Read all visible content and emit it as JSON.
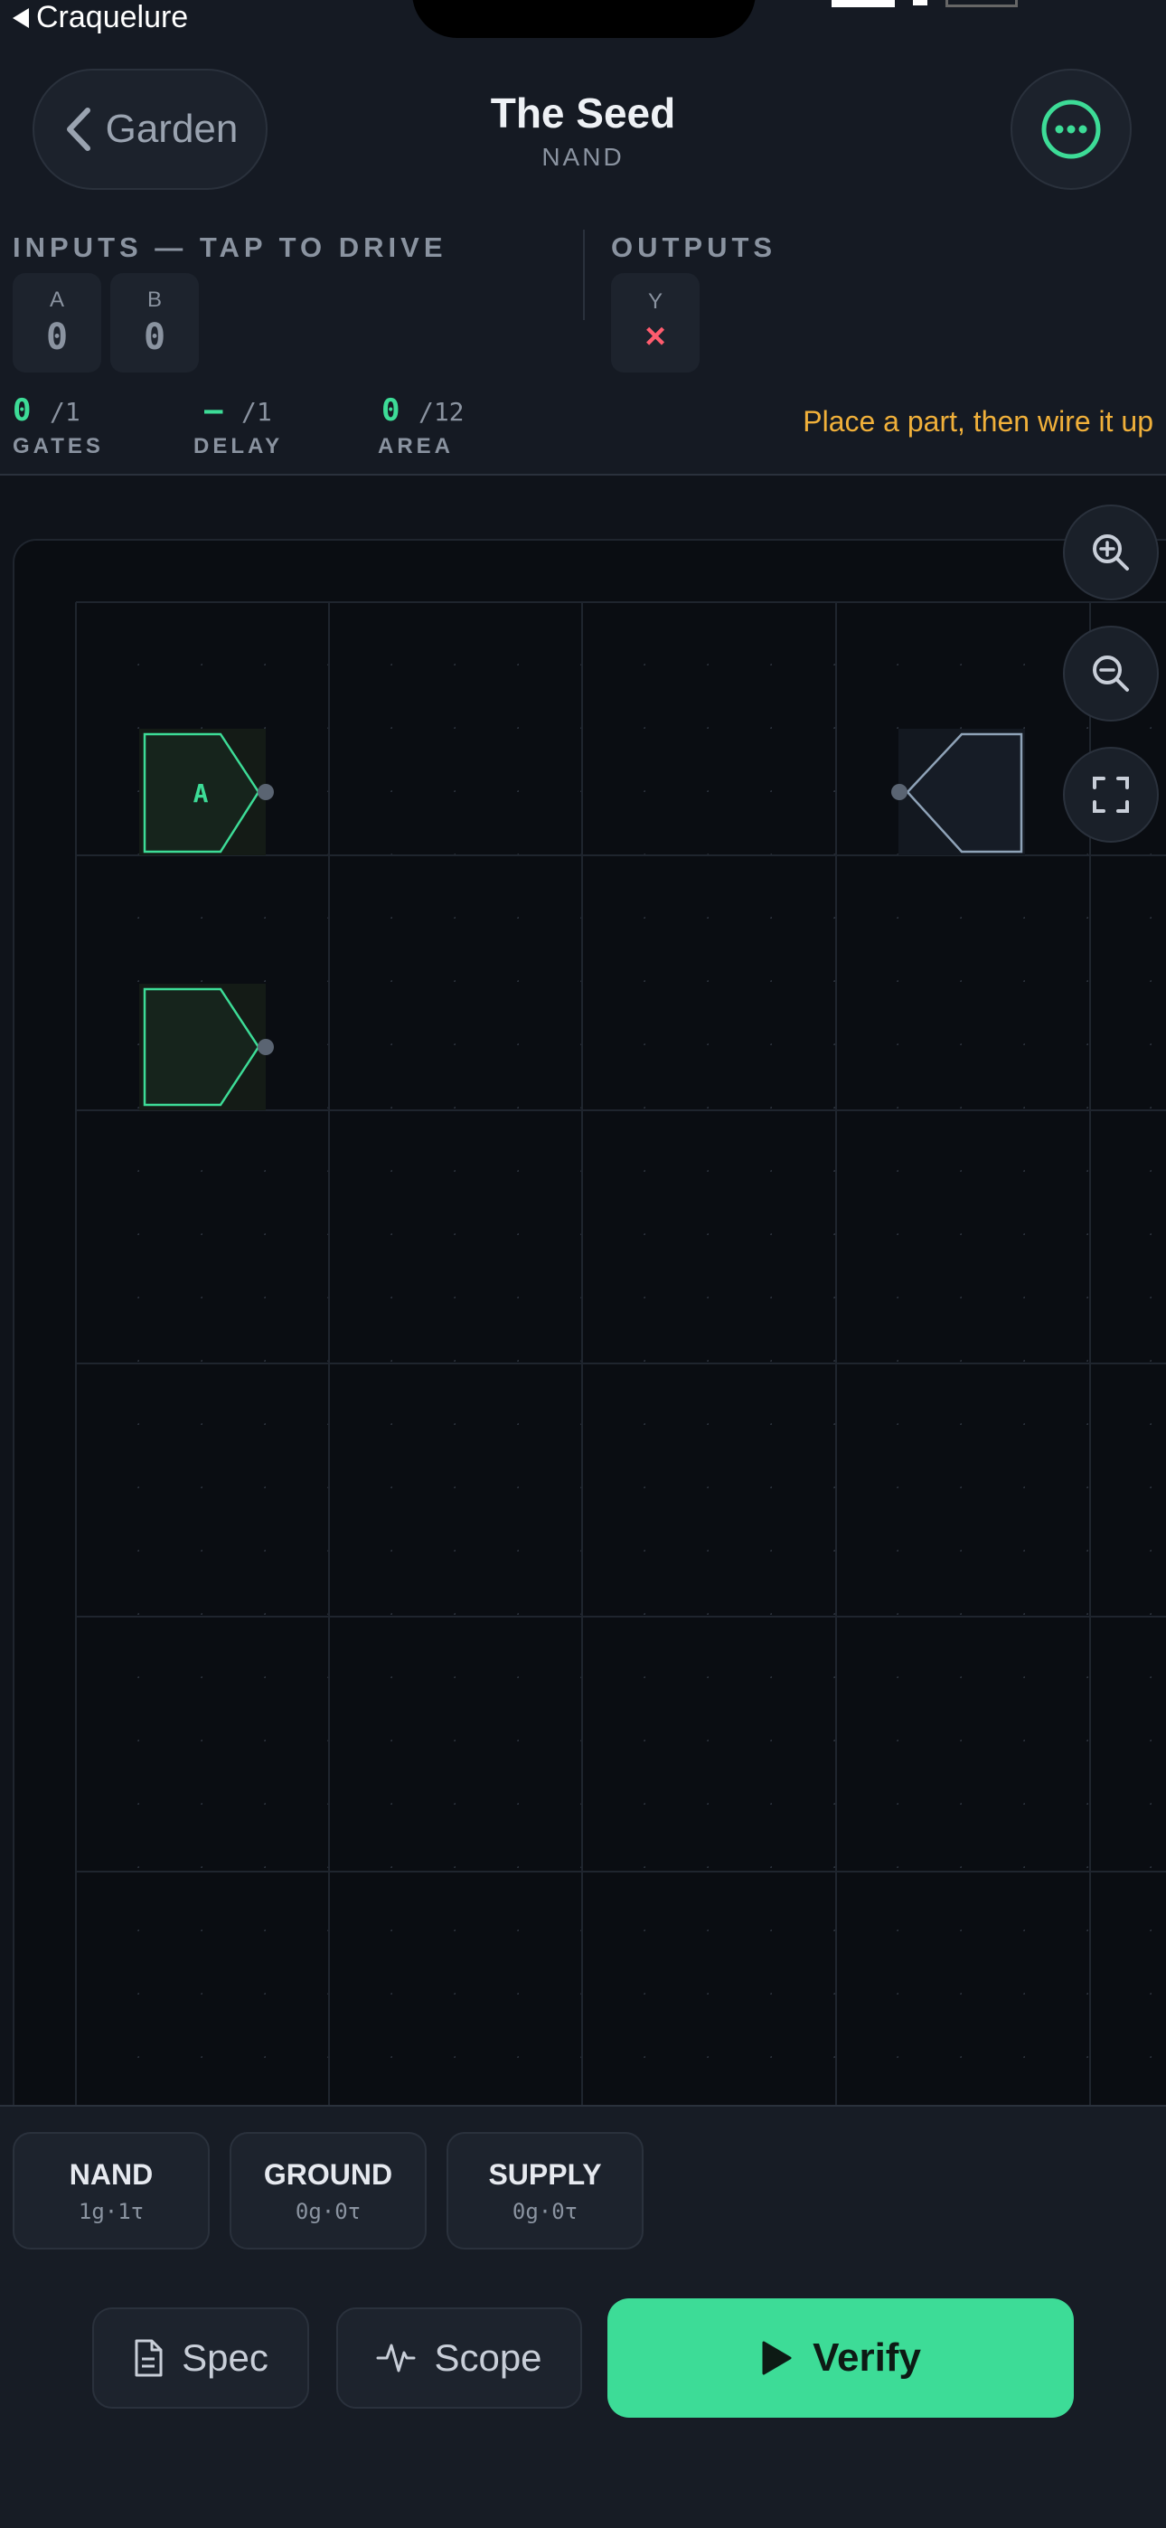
{
  "status_bar": {
    "back_app": "Craquelure"
  },
  "header": {
    "back_label": "Garden",
    "title": "The Seed",
    "subtitle": "NAND"
  },
  "inputs": {
    "label": "INPUTS — TAP TO DRIVE",
    "items": [
      {
        "name": "A",
        "value": "0"
      },
      {
        "name": "B",
        "value": "0"
      }
    ]
  },
  "outputs": {
    "label": "OUTPUTS",
    "items": [
      {
        "name": "Y",
        "value": "×"
      }
    ]
  },
  "stats": [
    {
      "value": "0",
      "max": "/1",
      "label": "GATES"
    },
    {
      "value": "—",
      "max": "/1",
      "label": "DELAY"
    },
    {
      "value": "0",
      "max": "/12",
      "label": "AREA"
    }
  ],
  "hint": "Place a part, then wire it up",
  "canvas": {
    "input_pin_a_label": "A"
  },
  "parts": [
    {
      "name": "NAND",
      "cost": "1g·1τ"
    },
    {
      "name": "GROUND",
      "cost": "0g·0τ"
    },
    {
      "name": "SUPPLY",
      "cost": "0g·0τ"
    }
  ],
  "actions": {
    "spec": "Spec",
    "scope": "Scope",
    "verify": "Verify"
  },
  "colors": {
    "accent": "#3ddc97",
    "warning": "#f0b03a",
    "error": "#ff5c6e"
  }
}
